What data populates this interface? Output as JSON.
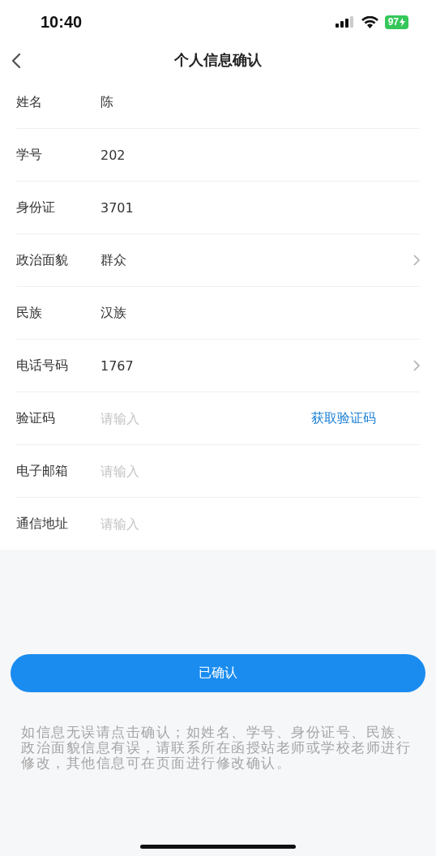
{
  "status_bar": {
    "time": "10:40",
    "battery": "97"
  },
  "nav": {
    "title": "个人信息确认"
  },
  "fields": [
    {
      "kind": "text",
      "label": "姓名",
      "value": "陈",
      "chevron": false
    },
    {
      "kind": "text",
      "label": "学号",
      "value": "202",
      "chevron": false
    },
    {
      "kind": "text",
      "label": "身份证",
      "value": "3701",
      "chevron": false
    },
    {
      "kind": "text",
      "label": "政治面貌",
      "value": "群众",
      "chevron": true
    },
    {
      "kind": "text",
      "label": "民族",
      "value": "汉族",
      "chevron": false
    },
    {
      "kind": "text",
      "label": "电话号码",
      "value": "1767",
      "chevron": true
    },
    {
      "kind": "input",
      "label": "验证码",
      "placeholder": "请输入",
      "action": "获取验证码"
    },
    {
      "kind": "input",
      "label": "电子邮箱",
      "placeholder": "请输入"
    },
    {
      "kind": "input",
      "label": "通信地址",
      "placeholder": "请输入"
    }
  ],
  "confirm_button": "已确认",
  "note": "如信息无误请点击确认；如姓名、学号、身份证号、民族、政治面貌信息有误，请联系所在函授站老师或学校老师进行修改，其他信息可在页面进行修改确认。"
}
